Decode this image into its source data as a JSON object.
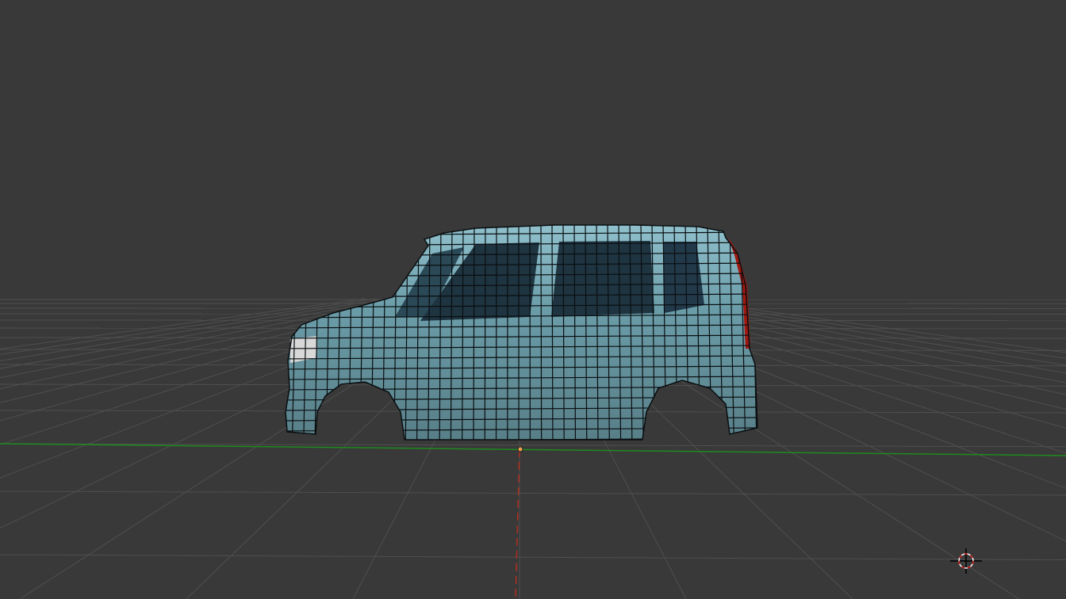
{
  "viewport": {
    "background": "#393939",
    "grid_color": "#4f4f4f",
    "x_axis_color": "#1f8a1f",
    "y_axis_color": "#b03020",
    "origin_color": "#f0a050"
  },
  "model": {
    "body_color": "#5e8f9a",
    "highlight_color": "#9cc9d4",
    "wire_color": "#0a0e10",
    "interior_color": "#1e3440",
    "taillight_color": "#a01810"
  },
  "icons": {
    "cursor": "3d-cursor-icon",
    "origin": "object-origin-icon"
  }
}
